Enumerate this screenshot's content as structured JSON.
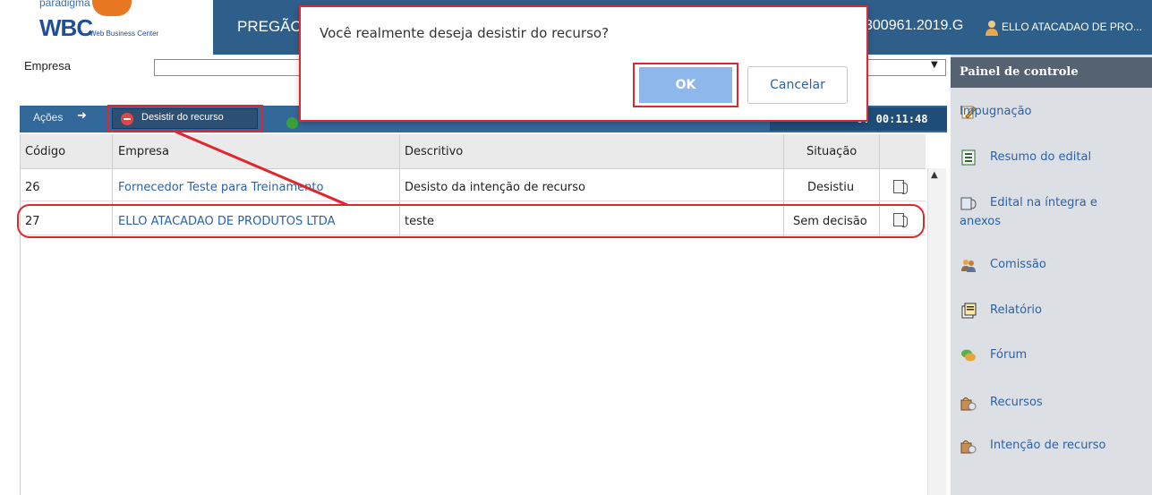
{
  "header": {
    "logo_tagline": "paradigma",
    "logo_text": "WBC",
    "logo_subtext": "Web Business Center",
    "title": "PREGÃO",
    "process_number": "300961.2019.G",
    "user_name": "ELLO ATACADAO DE PRO..."
  },
  "filter": {
    "empresa_label": "Empresa",
    "empresa_value": ""
  },
  "actions": {
    "acoes_label": "Ações",
    "desistir_label": "Desistir do recurso",
    "timer": "o: 00:11:48"
  },
  "table": {
    "columns": [
      "Código",
      "Empresa",
      "Descritivo",
      "Situação"
    ],
    "rows": [
      {
        "codigo": "26",
        "empresa": "Fornecedor Teste para Treinamento",
        "descritivo": "Desisto da intenção de recurso",
        "situacao": "Desistiu"
      },
      {
        "codigo": "27",
        "empresa": "ELLO ATACADAO DE PRODUTOS LTDA",
        "descritivo": "teste",
        "situacao": "Sem decisão"
      }
    ]
  },
  "sidebar": {
    "title": "Painel de controle",
    "items": [
      {
        "label": "Impugnação",
        "icon": "pencil-icon"
      },
      {
        "label": "Resumo do edital",
        "icon": "document-icon"
      },
      {
        "label": "Edital na íntegra e",
        "label2": "anexos",
        "icon": "attachment-icon"
      },
      {
        "label": "Comissão",
        "icon": "users-icon"
      },
      {
        "label": "Relatório",
        "icon": "report-icon"
      },
      {
        "label": "Fórum",
        "icon": "forum-icon"
      },
      {
        "label": "Recursos",
        "icon": "appeal-icon"
      },
      {
        "label": "Intenção de recurso",
        "icon": "appeal-intent-icon"
      }
    ]
  },
  "dialog": {
    "message": "Você realmente deseja desistir do recurso?",
    "ok_label": "OK",
    "cancel_label": "Cancelar"
  },
  "colors": {
    "header_blue": "#2e5f8a",
    "highlight_red": "#e0262e",
    "link_blue": "#2c62a8",
    "sidebar_title": "#556271"
  }
}
